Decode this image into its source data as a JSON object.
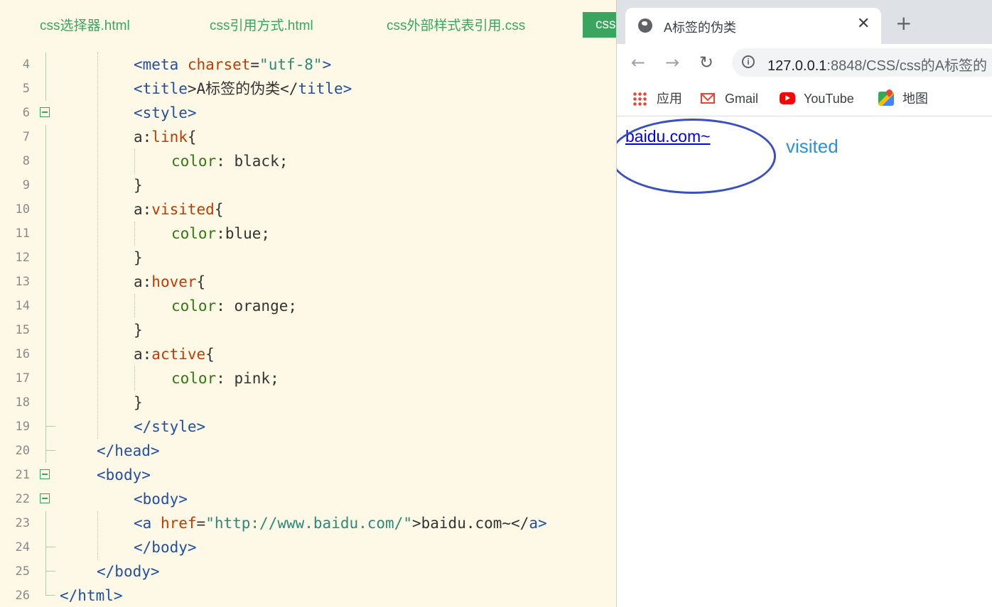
{
  "editor": {
    "tabs": [
      {
        "label": "css选择器.html"
      },
      {
        "label": "css引用方式.html"
      },
      {
        "label": "css外部样式表引用.css"
      },
      {
        "label": "css"
      }
    ],
    "lines": [
      {
        "n": "4"
      },
      {
        "n": "5"
      },
      {
        "n": "6"
      },
      {
        "n": "7"
      },
      {
        "n": "8"
      },
      {
        "n": "9"
      },
      {
        "n": "10"
      },
      {
        "n": "11"
      },
      {
        "n": "12"
      },
      {
        "n": "13"
      },
      {
        "n": "14"
      },
      {
        "n": "15"
      },
      {
        "n": "16"
      },
      {
        "n": "17"
      },
      {
        "n": "18"
      },
      {
        "n": "19"
      },
      {
        "n": "20"
      },
      {
        "n": "21"
      },
      {
        "n": "22"
      },
      {
        "n": "23"
      },
      {
        "n": "24"
      },
      {
        "n": "25"
      },
      {
        "n": "26"
      }
    ],
    "code": {
      "l4": {
        "open": "<",
        "tag": "meta",
        "attr": " charset",
        "eq": "=",
        "val": "\"utf-8\"",
        "close": ">"
      },
      "l5": {
        "open": "<",
        "tag": "title",
        "mid": ">A标签的伪类</",
        "tag2": "title",
        "close": ">"
      },
      "l6": {
        "open": "<",
        "tag": "style",
        "close": ">"
      },
      "l7": {
        "sel": "a:",
        "pseudo": "link",
        "brace": "{"
      },
      "l8": {
        "prop": "color",
        "rest": ": black;"
      },
      "l9": {
        "brace": "}"
      },
      "l10": {
        "sel": "a:",
        "pseudo": "visited",
        "brace": "{"
      },
      "l11": {
        "prop": "color",
        "rest": ":blue;"
      },
      "l12": {
        "brace": "}"
      },
      "l13": {
        "sel": "a:",
        "pseudo": "hover",
        "brace": "{"
      },
      "l14": {
        "prop": "color",
        "rest": ": orange;"
      },
      "l15": {
        "brace": "}"
      },
      "l16": {
        "sel": "a:",
        "pseudo": "active",
        "brace": "{"
      },
      "l17": {
        "prop": "color",
        "rest": ": pink;"
      },
      "l18": {
        "brace": "}"
      },
      "l19": {
        "open": "</",
        "tag": "style",
        "close": ">"
      },
      "l20": {
        "open": "</",
        "tag": "head",
        "close": ">"
      },
      "l21": {
        "open": "<",
        "tag": "body",
        "close": ">"
      },
      "l22": {
        "open": "<",
        "tag": "body",
        "close": ">"
      },
      "l23": {
        "open": "<",
        "tag": "a",
        "attr": " href",
        "eq": "=",
        "val": "\"http://www.baidu.com/\"",
        "mid": ">baidu.com~</",
        "tag2": "a",
        "close": ">"
      },
      "l24": {
        "open": "</",
        "tag": "body",
        "close": ">"
      },
      "l25": {
        "open": "</",
        "tag": "body",
        "close": ">"
      },
      "l26": {
        "open": "</",
        "tag": "html",
        "close": ">"
      }
    },
    "colors": {
      "accent": "#3aa55e",
      "background": "#fef9e7"
    }
  },
  "browser": {
    "tab_title": "A标签的伪类",
    "tab_close": "✕",
    "new_tab": "+",
    "back": "←",
    "forward": "→",
    "reload": "↻",
    "info": "i",
    "url_host": "127.0.0.1",
    "url_rest": ":8848/CSS/css的A标签的",
    "bookmarks": [
      {
        "label": "应用",
        "icon": "apps-icon"
      },
      {
        "label": "Gmail",
        "icon": "gmail-icon"
      },
      {
        "label": "YouTube",
        "icon": "youtube-icon"
      },
      {
        "label": "地图",
        "icon": "maps-icon"
      }
    ],
    "page": {
      "link_text": "baidu.com~",
      "annotation": "visited"
    },
    "colors": {
      "link": "#0000ee",
      "annotation": "#2e8fe0",
      "circle": "#3a4fc0"
    }
  }
}
